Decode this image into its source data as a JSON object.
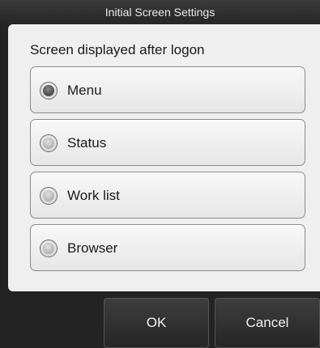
{
  "window": {
    "title": "Initial Screen Settings"
  },
  "section": {
    "label": "Screen displayed after logon"
  },
  "options": [
    {
      "label": "Menu",
      "selected": true
    },
    {
      "label": "Status",
      "selected": false
    },
    {
      "label": "Work list",
      "selected": false
    },
    {
      "label": "Browser",
      "selected": false
    }
  ],
  "buttons": {
    "ok": "OK",
    "cancel": "Cancel"
  }
}
